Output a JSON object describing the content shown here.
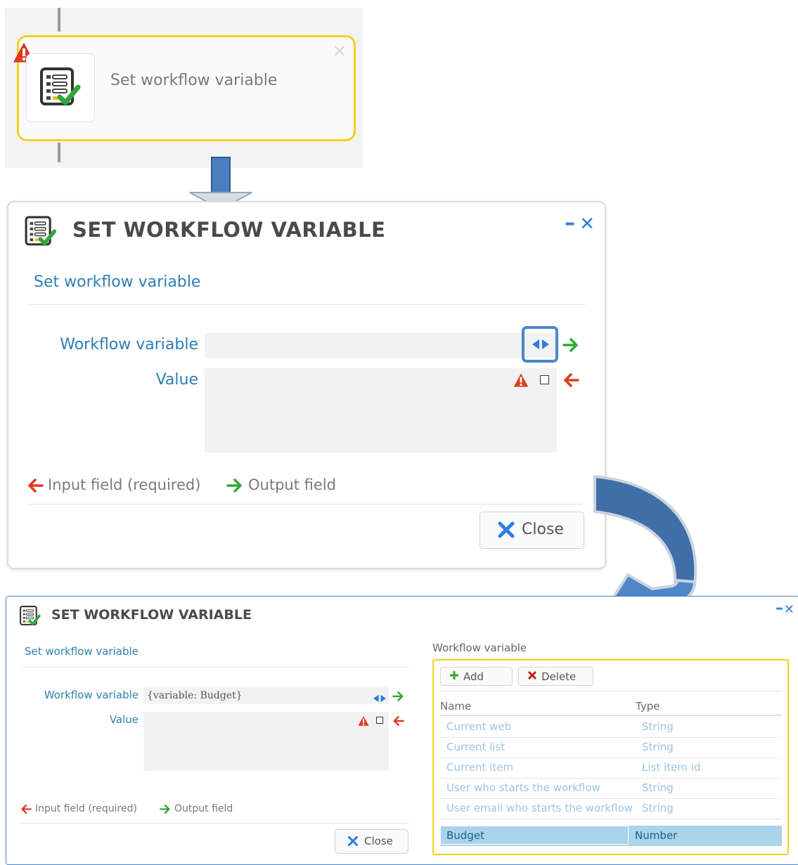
{
  "node": {
    "label": "Set workflow variable",
    "close_glyph": "✕",
    "icon": "checklist-icon",
    "status_icon": "warning-icon"
  },
  "dialog1": {
    "title": "SET WORKFLOW VARIABLE",
    "subtitle": "Set workflow variable",
    "workflow_variable_label": "Workflow variable",
    "value_label": "Value",
    "legend_input": "Input field (required)",
    "legend_output": "Output field",
    "close_label": "Close",
    "minimize_glyph": "–",
    "close_glyph": "✕"
  },
  "dialog2": {
    "title": "SET WORKFLOW VARIABLE",
    "subtitle": "Set workflow variable",
    "workflow_variable_label": "Workflow variable",
    "workflow_variable_value": "{variable: Budget}",
    "value_label": "Value",
    "legend_input": "Input field (required)",
    "legend_output": "Output field",
    "close_label": "Close",
    "minimize_glyph": "–",
    "close_glyph": "✕",
    "panel": {
      "caption": "Workflow variable",
      "add_label": "Add",
      "delete_label": "Delete",
      "col_name": "Name",
      "col_type": "Type",
      "rows": [
        {
          "name": "Current web",
          "type": "String"
        },
        {
          "name": "Current list",
          "type": "String"
        },
        {
          "name": "Current item",
          "type": "List item id."
        },
        {
          "name": "User who starts the workflow",
          "type": "String"
        },
        {
          "name": "User email who starts the workflow",
          "type": "String"
        },
        {
          "name": "Budget",
          "type": "Number"
        }
      ],
      "selected_row": "Budget"
    }
  },
  "colors": {
    "accent_blue": "#2e7fb3",
    "highlight_yellow": "#f2d31a",
    "input_arrow_red": "#e03a1e",
    "output_arrow_green": "#2fa83a",
    "selected_row_bg": "#a9d4ea",
    "flow_arrow_blue": "#4a7fbf"
  }
}
